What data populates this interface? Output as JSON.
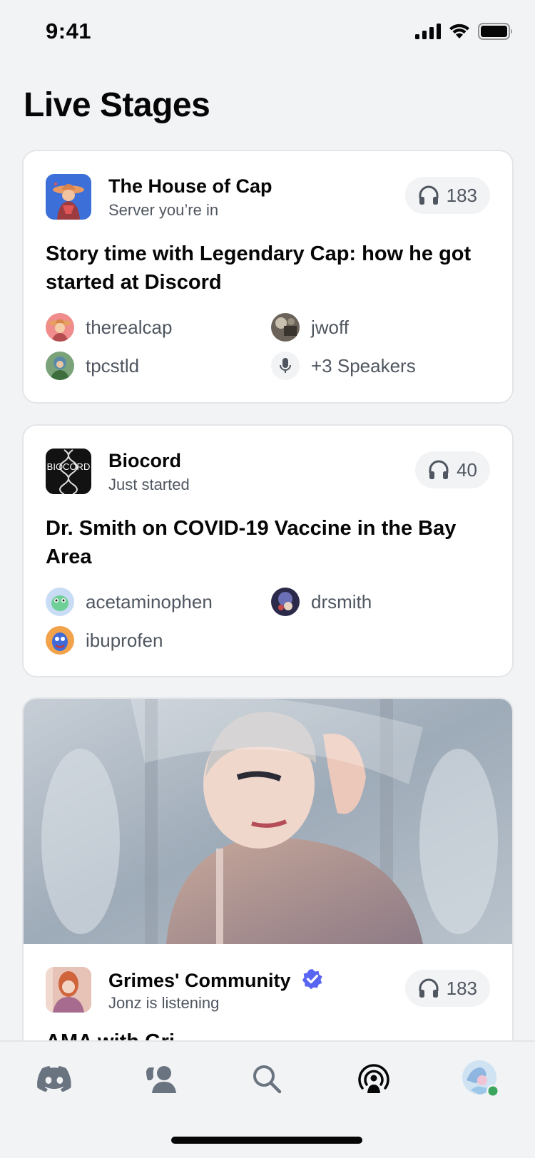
{
  "status_bar": {
    "time": "9:41"
  },
  "page": {
    "title": "Live Stages"
  },
  "stages": [
    {
      "server_name": "The House of Cap",
      "server_subtitle": "Server you’re in",
      "listeners": "183",
      "title": "Story time with Legendary Cap: how he got started at Discord",
      "speakers": [
        {
          "name": "therealcap"
        },
        {
          "name": "jwoff"
        },
        {
          "name": "tpcstld"
        },
        {
          "name": "+3 Speakers"
        }
      ]
    },
    {
      "server_name": "Biocord",
      "server_subtitle": "Just started",
      "server_icon_text": "BIOCORD",
      "listeners": "40",
      "title": "Dr. Smith on COVID-19 Vaccine in the Bay Area",
      "speakers": [
        {
          "name": "acetaminophen"
        },
        {
          "name": "drsmith"
        },
        {
          "name": "ibuprofen"
        }
      ]
    },
    {
      "server_name": "Grimes' Community",
      "server_subtitle": "Jonz is listening",
      "listeners": "183",
      "title": "AMA with Gri..."
    }
  ],
  "tab_bar": {
    "items": [
      {
        "icon": "discord-icon"
      },
      {
        "icon": "friends-icon"
      },
      {
        "icon": "search-icon"
      },
      {
        "icon": "live-stage-icon"
      },
      {
        "icon": "profile-avatar"
      }
    ]
  },
  "colors": {
    "background": "#f2f3f5",
    "card": "#ffffff",
    "text_primary": "#060607",
    "text_secondary": "#4f5660",
    "verified": "#5865f2",
    "online": "#3ba55d"
  }
}
